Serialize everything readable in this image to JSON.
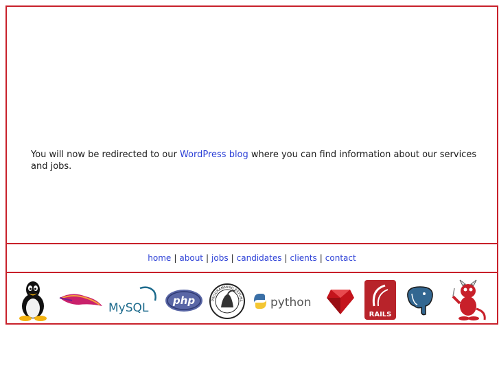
{
  "message": {
    "before": "You will now be redirected to our ",
    "link": "WordPress blog",
    "after": " where you can find information about our services and jobs."
  },
  "nav": {
    "items": [
      "home",
      "about",
      "jobs",
      "candidates",
      "clients",
      "contact"
    ],
    "separator": "|"
  },
  "logos": {
    "linux": "linux-tux-icon",
    "apache": "apache-feather-icon",
    "mysql": "MySQL",
    "php": "php",
    "perl": "PROGRAMMING REPUBLIC OF PERL",
    "python": "python",
    "ruby": "ruby-gem-icon",
    "rails": "RAILS",
    "postgresql": "postgresql-elephant-icon",
    "bsd": "bsd-daemon-icon"
  },
  "colors": {
    "border": "#c8202a",
    "link": "#2b3fd6"
  }
}
